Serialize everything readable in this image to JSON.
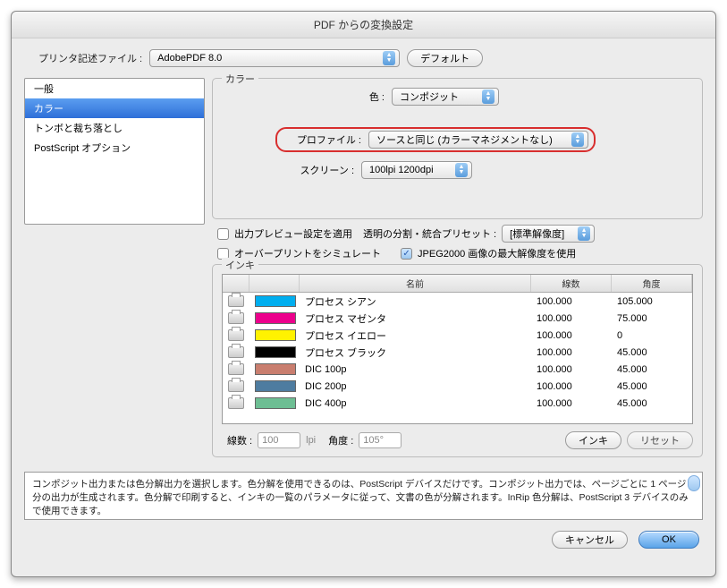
{
  "dialog": {
    "title": "PDF からの変換設定"
  },
  "topbar": {
    "printer_file_label": "プリンタ記述ファイル :",
    "printer_file_value": "AdobePDF 8.0",
    "default_btn": "デフォルト"
  },
  "sidebar": {
    "items": [
      {
        "label": "一般",
        "name": "sidebar-item-general"
      },
      {
        "label": "カラー",
        "name": "sidebar-item-color"
      },
      {
        "label": "トンボと裁ち落とし",
        "name": "sidebar-item-marks"
      },
      {
        "label": "PostScript オプション",
        "name": "sidebar-item-postscript"
      }
    ],
    "selected_index": 1
  },
  "color_section": {
    "legend": "カラー",
    "color_label": "色 :",
    "color_value": "コンポジット",
    "profile_label": "プロファイル :",
    "profile_value": "ソースと同じ (カラーマネジメントなし)",
    "screen_label": "スクリーン :",
    "screen_value": "100lpi 1200dpi"
  },
  "checks": {
    "apply_preview_label": "出力プレビュー設定を適用",
    "apply_preview_checked": false,
    "flatten_label": "透明の分割・統合プリセット :",
    "flatten_value": "[標準解像度]",
    "overprint_label": "オーバープリントをシミュレート",
    "overprint_checked": false,
    "jpeg2000_label": "JPEG2000 画像の最大解像度を使用",
    "jpeg2000_checked": true
  },
  "ink_section": {
    "legend": "インキ",
    "columns": {
      "name": "名前",
      "lines": "線数",
      "angle": "角度"
    },
    "rows": [
      {
        "color": "#00AEEF",
        "name": "プロセス シアン",
        "lines": "100.000",
        "angle": "105.000"
      },
      {
        "color": "#EC008C",
        "name": "プロセス マゼンタ",
        "lines": "100.000",
        "angle": "75.000"
      },
      {
        "color": "#FFF200",
        "name": "プロセス イエロー",
        "lines": "100.000",
        "angle": "0"
      },
      {
        "color": "#000000",
        "name": "プロセス ブラック",
        "lines": "100.000",
        "angle": "45.000"
      },
      {
        "color": "#C97E6F",
        "name": "DIC 100p",
        "lines": "100.000",
        "angle": "45.000"
      },
      {
        "color": "#4E7CA0",
        "name": "DIC 200p",
        "lines": "100.000",
        "angle": "45.000"
      },
      {
        "color": "#6DBE93",
        "name": "DIC 400p",
        "lines": "100.000",
        "angle": "45.000"
      }
    ],
    "bottom": {
      "lines_label": "線数 :",
      "lines_value": "100",
      "lines_unit": "lpi",
      "angle_label": "角度 :",
      "angle_value": "105°",
      "ink_btn": "インキ",
      "reset_btn": "リセット"
    }
  },
  "description": "コンポジット出力または色分解出力を選択します。色分解を使用できるのは、PostScript デバイスだけです。コンポジット出力では、ページごとに 1 ページ分の出力が生成されます。色分解で印刷すると、インキの一覧のパラメータに従って、文書の色が分解されます。InRip 色分解は、PostScript 3 デバイスのみで使用できます。",
  "footer": {
    "cancel": "キャンセル",
    "ok": "OK"
  }
}
